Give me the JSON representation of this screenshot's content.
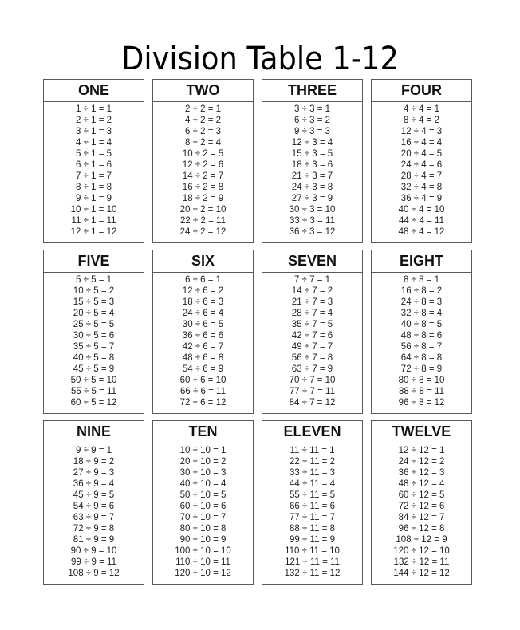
{
  "title": "Division Table 1-12",
  "tables": [
    {
      "name": "ONE",
      "rows": [
        "1 ÷ 1 = 1",
        "2 ÷ 1 = 2",
        "3 ÷ 1 = 3",
        "4 ÷ 1 = 4",
        "5 ÷ 1 = 5",
        "6 ÷ 1 = 6",
        "7 ÷ 1 = 7",
        "8 ÷ 1 = 8",
        "9 ÷ 1 = 9",
        "10 ÷ 1 = 10",
        "11 ÷ 1 = 11",
        "12 ÷ 1 = 12"
      ]
    },
    {
      "name": "TWO",
      "rows": [
        "2 ÷ 2 = 1",
        "4 ÷ 2 = 2",
        "6 ÷ 2 = 3",
        "8 ÷ 2 = 4",
        "10 ÷ 2 = 5",
        "12 ÷ 2 = 6",
        "14 ÷ 2 = 7",
        "16 ÷ 2 = 8",
        "18 ÷ 2 = 9",
        "20 ÷ 2 = 10",
        "22 ÷ 2 = 11",
        "24 ÷ 2 = 12"
      ]
    },
    {
      "name": "THREE",
      "rows": [
        "3 ÷ 3 = 1",
        "6 ÷ 3 = 2",
        "9 ÷ 3 = 3",
        "12 ÷ 3 = 4",
        "15 ÷ 3 = 5",
        "18 ÷ 3 = 6",
        "21 ÷ 3 = 7",
        "24 ÷ 3 = 8",
        "27 ÷ 3 = 9",
        "30 ÷ 3 = 10",
        "33 ÷ 3 = 11",
        "36 ÷ 3 = 12"
      ]
    },
    {
      "name": "FOUR",
      "rows": [
        "4 ÷ 4 = 1",
        "8 ÷ 4 = 2",
        "12 ÷ 4 = 3",
        "16 ÷ 4 = 4",
        "20 ÷ 4 = 5",
        "24 ÷ 4 = 6",
        "28 ÷ 4 = 7",
        "32 ÷ 4 = 8",
        "36 ÷ 4 = 9",
        "40 ÷ 4 = 10",
        "44 ÷ 4 = 11",
        "48 ÷ 4 = 12"
      ]
    },
    {
      "name": "FIVE",
      "rows": [
        "5 ÷ 5 = 1",
        "10 ÷ 5 = 2",
        "15 ÷ 5 = 3",
        "20 ÷ 5 = 4",
        "25 ÷ 5 = 5",
        "30 ÷ 5 = 6",
        "35 ÷ 5 = 7",
        "40 ÷ 5 = 8",
        "45 ÷ 5 = 9",
        "50 ÷ 5 = 10",
        "55 ÷ 5 = 11",
        "60 ÷ 5 = 12"
      ]
    },
    {
      "name": "SIX",
      "rows": [
        "6 ÷ 6 = 1",
        "12 ÷ 6 = 2",
        "18 ÷ 6 = 3",
        "24 ÷ 6 = 4",
        "30 ÷ 6 = 5",
        "36 ÷ 6 = 6",
        "42 ÷ 6 = 7",
        "48 ÷ 6 = 8",
        "54 ÷ 6 = 9",
        "60 ÷ 6 = 10",
        "66 ÷ 6 = 11",
        "72 ÷ 6 = 12"
      ]
    },
    {
      "name": "SEVEN",
      "rows": [
        "7 ÷ 7 = 1",
        "14 ÷ 7 = 2",
        "21 ÷ 7 = 3",
        "28 ÷ 7 = 4",
        "35 ÷ 7 = 5",
        "42 ÷ 7 = 6",
        "49 ÷ 7 = 7",
        "56 ÷ 7 = 8",
        "63 ÷ 7 = 9",
        "70 ÷ 7 = 10",
        "77 ÷ 7 = 11",
        "84 ÷ 7 = 12"
      ]
    },
    {
      "name": "EIGHT",
      "rows": [
        "8 ÷ 8 = 1",
        "16 ÷ 8 = 2",
        "24 ÷ 8 = 3",
        "32 ÷ 8 = 4",
        "40 ÷ 8 = 5",
        "48 ÷ 8 = 6",
        "56 ÷ 8 = 7",
        "64 ÷ 8 = 8",
        "72 ÷ 8 = 9",
        "80 ÷ 8 = 10",
        "88 ÷ 8 = 11",
        "96 ÷ 8 = 12"
      ]
    },
    {
      "name": "NINE",
      "rows": [
        "9 ÷ 9 = 1",
        "18 ÷ 9 = 2",
        "27 ÷ 9 = 3",
        "36 ÷ 9 = 4",
        "45 ÷ 9 = 5",
        "54 ÷ 9 = 6",
        "63 ÷ 9 = 7",
        "72 ÷ 9 = 8",
        "81 ÷ 9 = 9",
        "90 ÷ 9 = 10",
        "99 ÷ 9 = 11",
        "108 ÷ 9 = 12"
      ]
    },
    {
      "name": "TEN",
      "rows": [
        "10 ÷ 10 = 1",
        "20 ÷ 10 = 2",
        "30 ÷ 10 = 3",
        "40 ÷ 10 = 4",
        "50 ÷ 10 = 5",
        "60 ÷ 10 = 6",
        "70 ÷ 10 = 7",
        "80 ÷ 10 = 8",
        "90 ÷ 10 = 9",
        "100 ÷ 10 = 10",
        "110 ÷ 10 = 11",
        "120 ÷ 10 = 12"
      ]
    },
    {
      "name": "ELEVEN",
      "rows": [
        "11 ÷ 11 = 1",
        "22 ÷ 11 = 2",
        "33 ÷ 11 = 3",
        "44 ÷ 11 = 4",
        "55 ÷ 11 = 5",
        "66 ÷ 11 = 6",
        "77 ÷ 11 = 7",
        "88 ÷ 11 = 8",
        "99 ÷ 11 = 9",
        "110 ÷ 11 = 10",
        "121 ÷ 11 = 11",
        "132 ÷ 11 = 12"
      ]
    },
    {
      "name": "TWELVE",
      "rows": [
        "12 ÷ 12 = 1",
        "24 ÷ 12 = 2",
        "36 ÷ 12 = 3",
        "48 ÷ 12 = 4",
        "60 ÷ 12 = 5",
        "72 ÷ 12 = 6",
        "84 ÷ 12 = 7",
        "96 ÷ 12 = 8",
        "108 ÷ 12 = 9",
        "120 ÷ 12 = 10",
        "132 ÷ 12 = 11",
        "144 ÷ 12 = 12"
      ]
    }
  ]
}
